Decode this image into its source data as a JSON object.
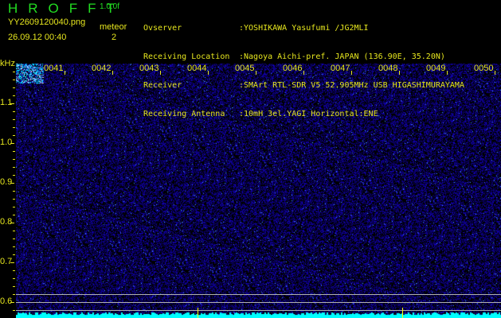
{
  "header": {
    "title": "HROFFT",
    "version": "1.0.0f",
    "filename": "YY2609120040.png",
    "datetime": "26.09.12 00:40",
    "meteor_label": "meteor",
    "meteor_count": "2"
  },
  "info": [
    {
      "key": "Ovserver",
      "value": ":YOSHIKAWA Yasufumi /JG2MLI"
    },
    {
      "key": "Receiving Location",
      "value": ":Nagoya Aichi-pref. JAPAN (136.90E, 35.20N)"
    },
    {
      "key": "Receiver",
      "value": ":SMArt RTL-SDR V5 52.905MHz USB HIGASHIMURAYAMA"
    },
    {
      "key": "Receiving Antenna",
      "value": ":10mH 3el.YAGI Horizontal:ENE"
    }
  ],
  "waterfall": {
    "y_unit": "kHz",
    "y_labels": [
      "1.1",
      "1.0",
      "0.9",
      "0.8",
      "0.7",
      "0.6"
    ],
    "time_labels": [
      "0041",
      "0042",
      "0043",
      "0044",
      "0045",
      "0046",
      "0047",
      "0048",
      "0049",
      "0050"
    ],
    "colors": {
      "background": "#000000",
      "noise": "#1a1acc",
      "spectrum": "#00ffff",
      "text": "#e6e61e"
    }
  }
}
